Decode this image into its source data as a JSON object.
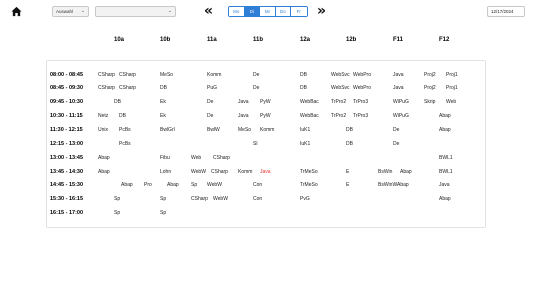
{
  "toolbar": {
    "select_main": "Auswahl",
    "select_second": "",
    "prev": "«",
    "next": "»",
    "days": [
      "Mo",
      "Di",
      "Mi",
      "Do",
      "Fr"
    ],
    "active_day": "Di",
    "date": "12/17/2024"
  },
  "columns": [
    "10a",
    "10b",
    "11a",
    "11b",
    "12a",
    "12b",
    "F11",
    "F12"
  ],
  "times": [
    "08:00 - 08:45",
    "08:45 - 09:30",
    "09:45 - 10:30",
    "10:30 - 11:15",
    "11:30 - 12:15",
    "12:15 - 13:00",
    "13:00 - 13:45",
    "13:45 - 14:30",
    "14:45 - 15:30",
    "15:30 - 16:15",
    "16:15 - 17:00"
  ],
  "cells": [
    [
      "CSharp",
      "CSharp",
      "MeSo",
      "Komm",
      "De",
      "DB",
      "WebSvc",
      "WebPro",
      "Java",
      "Proj2",
      "Proj1"
    ],
    [
      "CSharp",
      "CSharp",
      "DB",
      "PuG",
      "De",
      "DB",
      "WebSvc",
      "WebPro",
      "Java",
      "Proj2",
      "Proj1"
    ],
    [
      "DB",
      "Ek",
      "De",
      "Java",
      "PyW",
      "WebBac",
      "TrPro2",
      "TrPro3",
      "WiPuG",
      "Skrip",
      "Web"
    ],
    [
      "Netz",
      "DB",
      "Ek",
      "De",
      "Java",
      "PyW",
      "WebBac",
      "TrPro2",
      "TrPro3",
      "WiPuG",
      "Abap"
    ],
    [
      "Unix",
      "PcBs",
      "BwlGrl",
      "BwlW",
      "MeSo",
      "Komm",
      "IuK1",
      "DB",
      "De",
      "Abap"
    ],
    [
      "PcBs",
      "Sl",
      "IuK1",
      "DB",
      "De"
    ],
    [
      "Abap",
      "Fibu",
      "Web",
      "CSharp",
      "BWL1"
    ],
    [
      "Abap",
      "Lohn",
      "WebW",
      "CSharp",
      "Komm",
      "Java",
      "TrMeSo",
      "E",
      "BsWin",
      "Abap",
      "BWL1"
    ],
    [
      "Abap",
      "Pro",
      "Abap",
      "Sp",
      "WebW",
      "Con",
      "TrMeSo",
      "E",
      "BsWinWAbap",
      "Java"
    ],
    [
      "Sp",
      "Sp",
      "CSharp",
      "WebW",
      "Con",
      "PvG",
      "Abap"
    ],
    [
      "Sp",
      "Sp"
    ]
  ],
  "highlight_color": "#e0322e",
  "accent_color": "#2f7fd6"
}
